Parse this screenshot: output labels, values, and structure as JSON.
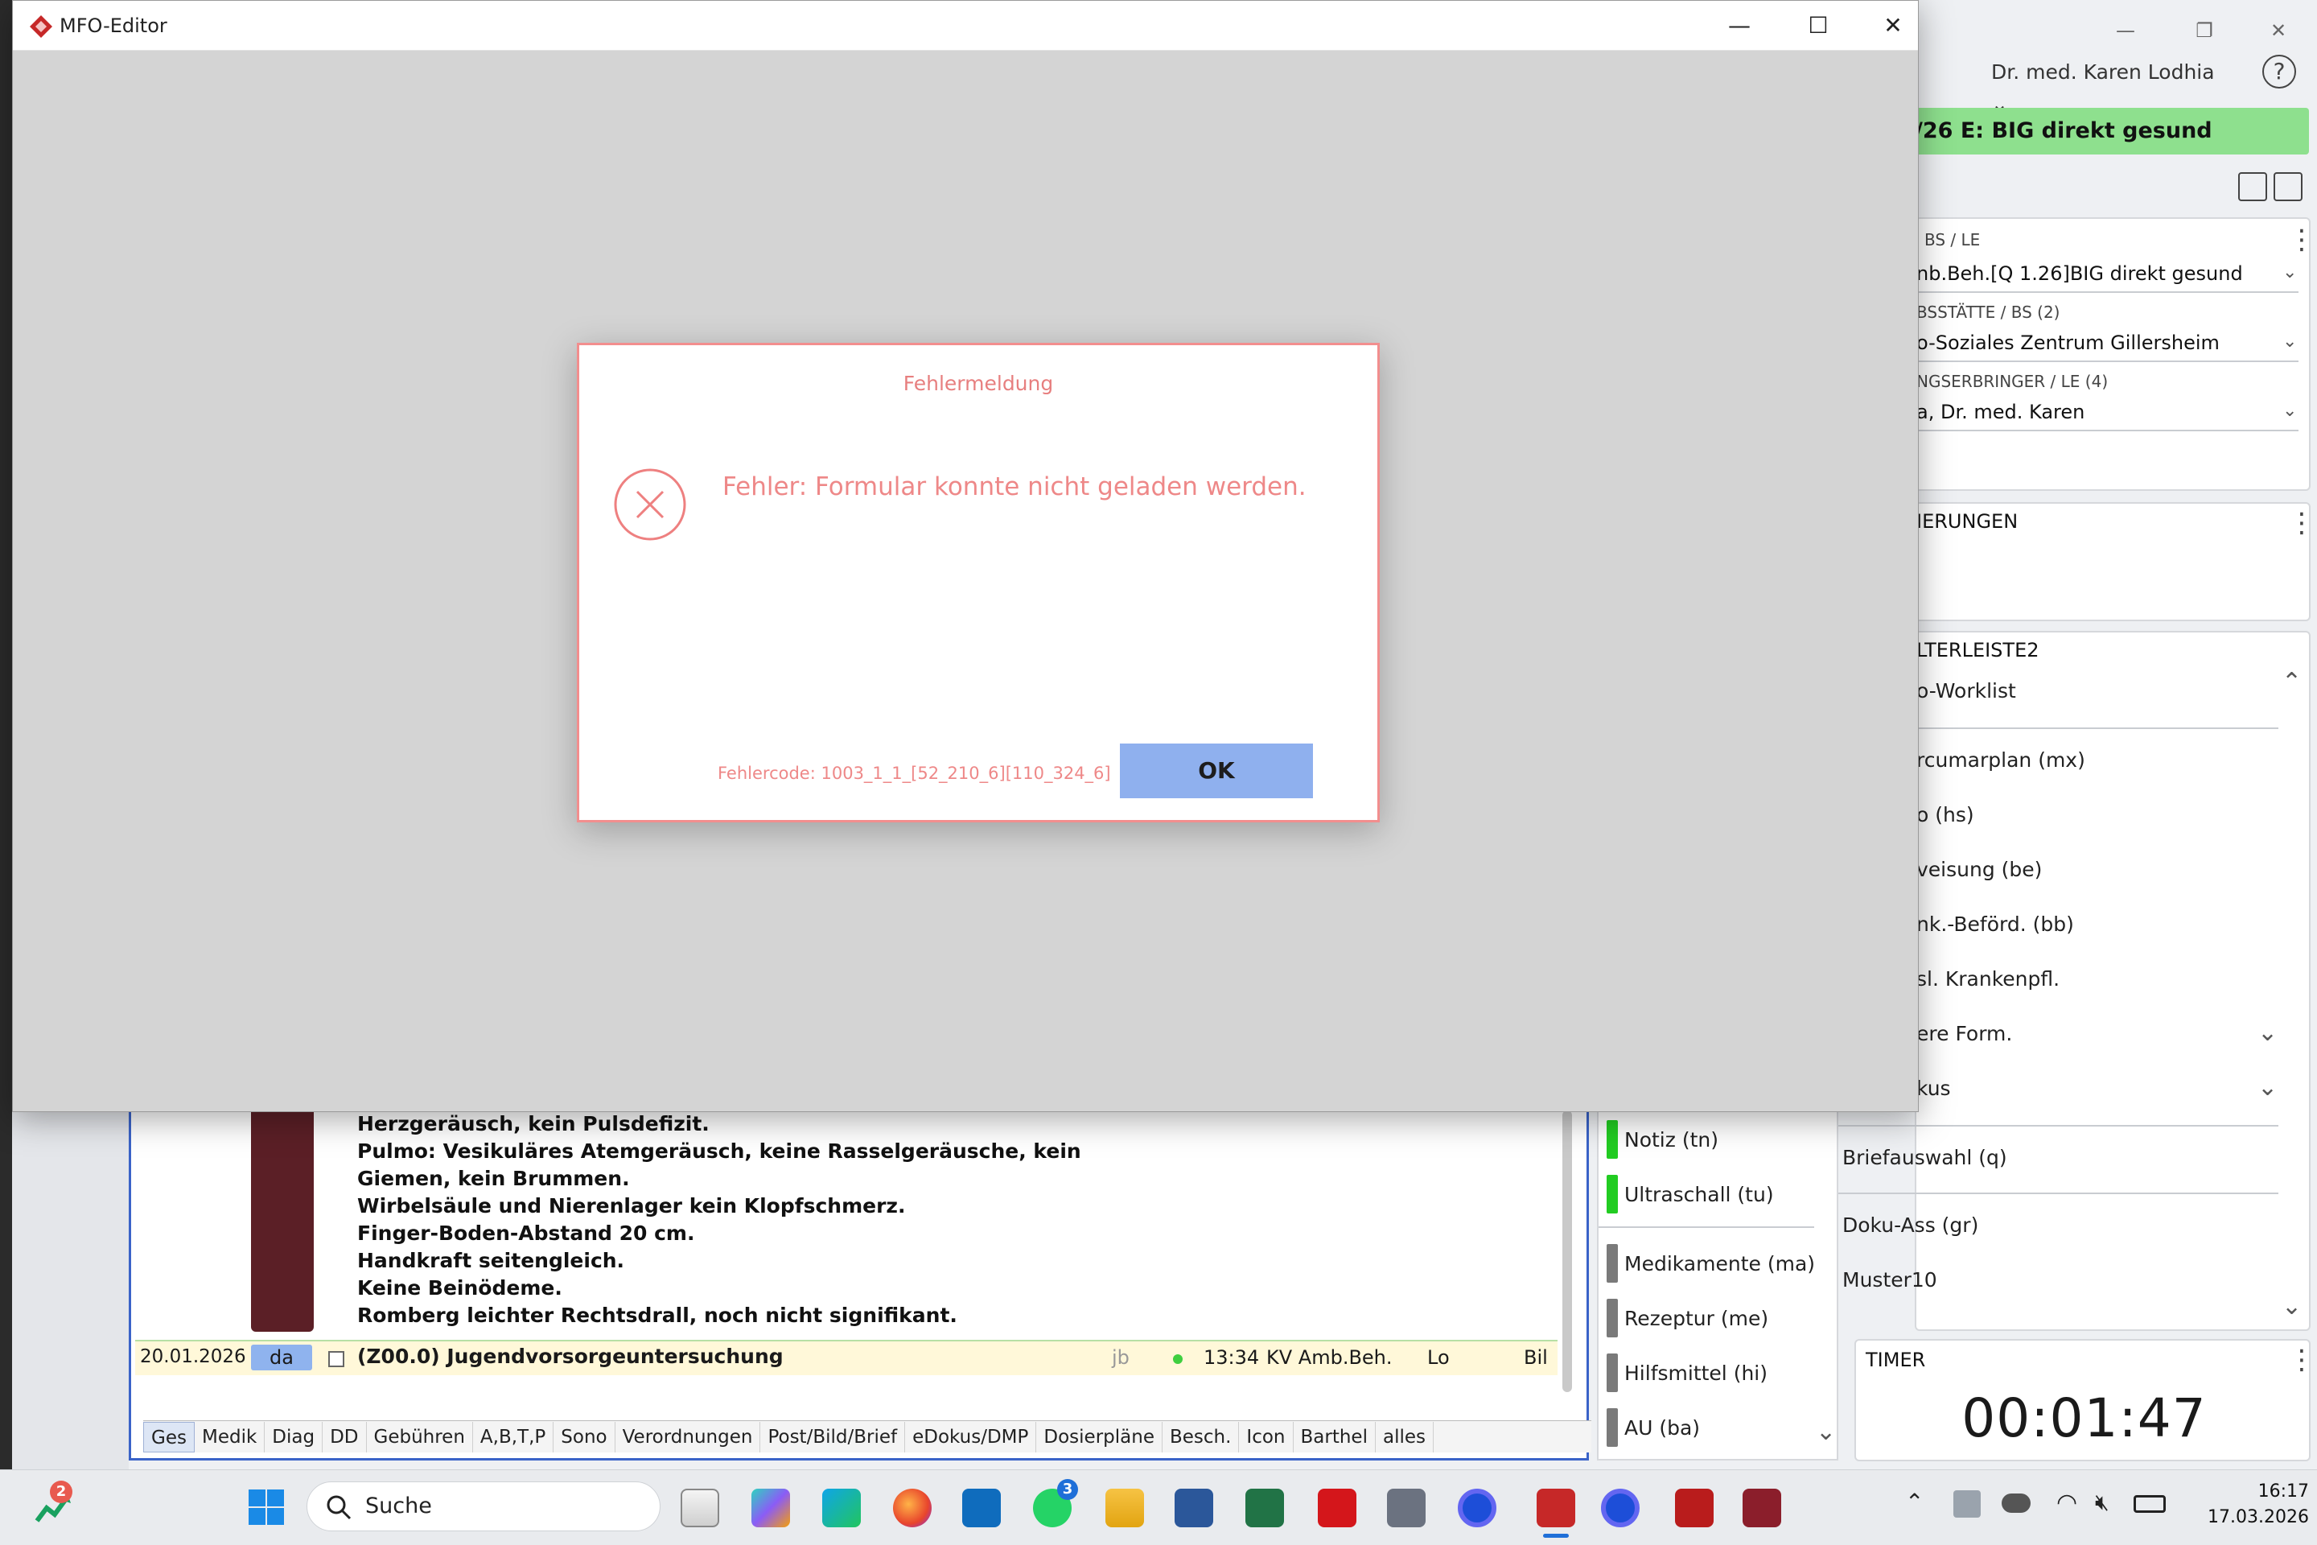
{
  "window": {
    "title": "MFO-Editor",
    "min_glyph": "—",
    "max_glyph": "☐",
    "close_glyph": "✕"
  },
  "dialog": {
    "title": "Fehlermeldung",
    "message": "Fehler: Formular konnte nicht geladen werden.",
    "code": "Fehlercode: 1003_1_1_[52_210_6][110_324_6]",
    "ok_label": "OK",
    "icon": "error-circle-x-icon"
  },
  "background": {
    "user": "Dr. med. Karen Lodhia",
    "help_glyph": "?",
    "banner": "/26 E: BIG direkt gesund",
    "bs_le": {
      "label": "BS / LE",
      "value": "nb.Beh.[Q 1.26]BIG direkt gesund",
      "bs_label": "BSSTÄTTE / BS (2)",
      "bs_value": "o-Soziales Zentrum Gillersheim",
      "le_label": "NGSERBRINGER / LE (4)",
      "le_value": "a, Dr. med. Karen"
    },
    "ierungen_label": "IERUNGEN",
    "leiste_label": "LTERLEISTE2",
    "leiste_items": [
      "o-Worklist",
      "rcumarplan (mx)",
      "o (hs)",
      "veisung (be)",
      "nk.-Beförd. (bb)",
      "sl. Krankenpfl.",
      "ere Form.",
      "kus"
    ],
    "right_items": [
      {
        "label": "Briefauswahl (q)",
        "color": "#f2f200"
      },
      {
        "label": "Doku-Ass (gr)",
        "color": "#f2f200"
      },
      {
        "label": "Muster10",
        "color": "#7a7a7a"
      }
    ],
    "timer_label": "TIMER",
    "timer_value": "00:01:47",
    "record_lines": [
      "Herzgeräusch, kein Pulsdefizit.",
      "Pulmo: Vesikuläres Atemgeräusch, keine Rasselgeräusche, kein",
      "Giemen, kein Brummen.",
      "Wirbelsäule und Nierenlager kein Klopfschmerz.",
      "Finger-Boden-Abstand 20 cm.",
      "Handkraft seitengleich.",
      "Keine Beinödeme.",
      "Romberg leichter Rechtsdrall, noch nicht signifikant."
    ],
    "entry": {
      "date": "20.01.2026",
      "type": "da",
      "text": "(Z00.0) Jugendvorsorgeuntersuchung",
      "user": "jb",
      "time": "13:34",
      "kv": "KV Amb.Beh.",
      "lo": "Lo",
      "bil": "Bil"
    },
    "tabs": [
      "Ges",
      "Medik",
      "Diag",
      "DD",
      "Gebühren",
      "A,B,T,P",
      "Sono",
      "Verordnungen",
      "Post/Bild/Brief",
      "eDokus/DMP",
      "Dosierpläne",
      "Besch.",
      "Icon",
      "Barthel",
      "alles"
    ],
    "col3_items": [
      {
        "label": "Notiz (tn)",
        "color": "#22cc22"
      },
      {
        "label": "Ultraschall (tu)",
        "color": "#22cc22"
      },
      {
        "label": "Medikamente (ma)",
        "color": "#7a7a7a"
      },
      {
        "label": "Rezeptur (me)",
        "color": "#7a7a7a"
      },
      {
        "label": "Hilfsmittel (hi)",
        "color": "#7a7a7a"
      },
      {
        "label": "AU (ba)",
        "color": "#7a7a7a"
      }
    ]
  },
  "taskbar": {
    "search_placeholder": "Suche",
    "time": "16:17",
    "date": "17.03.2026",
    "widget_badge": "2",
    "whatsapp_badge": "3"
  }
}
